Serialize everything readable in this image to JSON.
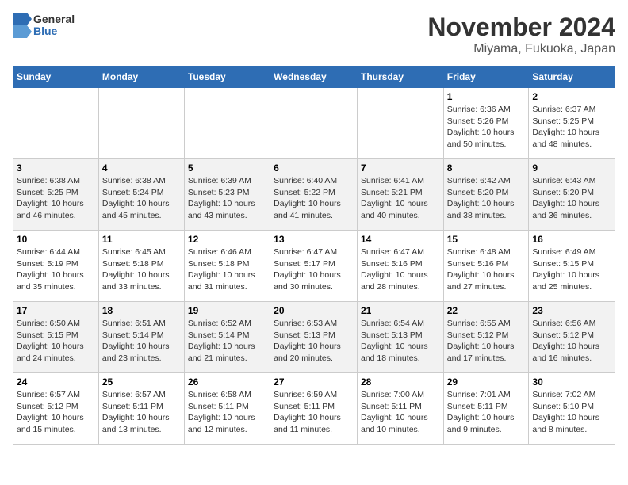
{
  "header": {
    "logo_general": "General",
    "logo_blue": "Blue",
    "title": "November 2024",
    "subtitle": "Miyama, Fukuoka, Japan"
  },
  "days_of_week": [
    "Sunday",
    "Monday",
    "Tuesday",
    "Wednesday",
    "Thursday",
    "Friday",
    "Saturday"
  ],
  "weeks": [
    [
      {
        "day": "",
        "info": ""
      },
      {
        "day": "",
        "info": ""
      },
      {
        "day": "",
        "info": ""
      },
      {
        "day": "",
        "info": ""
      },
      {
        "day": "",
        "info": ""
      },
      {
        "day": "1",
        "info": "Sunrise: 6:36 AM\nSunset: 5:26 PM\nDaylight: 10 hours and 50 minutes."
      },
      {
        "day": "2",
        "info": "Sunrise: 6:37 AM\nSunset: 5:25 PM\nDaylight: 10 hours and 48 minutes."
      }
    ],
    [
      {
        "day": "3",
        "info": "Sunrise: 6:38 AM\nSunset: 5:25 PM\nDaylight: 10 hours and 46 minutes."
      },
      {
        "day": "4",
        "info": "Sunrise: 6:38 AM\nSunset: 5:24 PM\nDaylight: 10 hours and 45 minutes."
      },
      {
        "day": "5",
        "info": "Sunrise: 6:39 AM\nSunset: 5:23 PM\nDaylight: 10 hours and 43 minutes."
      },
      {
        "day": "6",
        "info": "Sunrise: 6:40 AM\nSunset: 5:22 PM\nDaylight: 10 hours and 41 minutes."
      },
      {
        "day": "7",
        "info": "Sunrise: 6:41 AM\nSunset: 5:21 PM\nDaylight: 10 hours and 40 minutes."
      },
      {
        "day": "8",
        "info": "Sunrise: 6:42 AM\nSunset: 5:20 PM\nDaylight: 10 hours and 38 minutes."
      },
      {
        "day": "9",
        "info": "Sunrise: 6:43 AM\nSunset: 5:20 PM\nDaylight: 10 hours and 36 minutes."
      }
    ],
    [
      {
        "day": "10",
        "info": "Sunrise: 6:44 AM\nSunset: 5:19 PM\nDaylight: 10 hours and 35 minutes."
      },
      {
        "day": "11",
        "info": "Sunrise: 6:45 AM\nSunset: 5:18 PM\nDaylight: 10 hours and 33 minutes."
      },
      {
        "day": "12",
        "info": "Sunrise: 6:46 AM\nSunset: 5:18 PM\nDaylight: 10 hours and 31 minutes."
      },
      {
        "day": "13",
        "info": "Sunrise: 6:47 AM\nSunset: 5:17 PM\nDaylight: 10 hours and 30 minutes."
      },
      {
        "day": "14",
        "info": "Sunrise: 6:47 AM\nSunset: 5:16 PM\nDaylight: 10 hours and 28 minutes."
      },
      {
        "day": "15",
        "info": "Sunrise: 6:48 AM\nSunset: 5:16 PM\nDaylight: 10 hours and 27 minutes."
      },
      {
        "day": "16",
        "info": "Sunrise: 6:49 AM\nSunset: 5:15 PM\nDaylight: 10 hours and 25 minutes."
      }
    ],
    [
      {
        "day": "17",
        "info": "Sunrise: 6:50 AM\nSunset: 5:15 PM\nDaylight: 10 hours and 24 minutes."
      },
      {
        "day": "18",
        "info": "Sunrise: 6:51 AM\nSunset: 5:14 PM\nDaylight: 10 hours and 23 minutes."
      },
      {
        "day": "19",
        "info": "Sunrise: 6:52 AM\nSunset: 5:14 PM\nDaylight: 10 hours and 21 minutes."
      },
      {
        "day": "20",
        "info": "Sunrise: 6:53 AM\nSunset: 5:13 PM\nDaylight: 10 hours and 20 minutes."
      },
      {
        "day": "21",
        "info": "Sunrise: 6:54 AM\nSunset: 5:13 PM\nDaylight: 10 hours and 18 minutes."
      },
      {
        "day": "22",
        "info": "Sunrise: 6:55 AM\nSunset: 5:12 PM\nDaylight: 10 hours and 17 minutes."
      },
      {
        "day": "23",
        "info": "Sunrise: 6:56 AM\nSunset: 5:12 PM\nDaylight: 10 hours and 16 minutes."
      }
    ],
    [
      {
        "day": "24",
        "info": "Sunrise: 6:57 AM\nSunset: 5:12 PM\nDaylight: 10 hours and 15 minutes."
      },
      {
        "day": "25",
        "info": "Sunrise: 6:57 AM\nSunset: 5:11 PM\nDaylight: 10 hours and 13 minutes."
      },
      {
        "day": "26",
        "info": "Sunrise: 6:58 AM\nSunset: 5:11 PM\nDaylight: 10 hours and 12 minutes."
      },
      {
        "day": "27",
        "info": "Sunrise: 6:59 AM\nSunset: 5:11 PM\nDaylight: 10 hours and 11 minutes."
      },
      {
        "day": "28",
        "info": "Sunrise: 7:00 AM\nSunset: 5:11 PM\nDaylight: 10 hours and 10 minutes."
      },
      {
        "day": "29",
        "info": "Sunrise: 7:01 AM\nSunset: 5:11 PM\nDaylight: 10 hours and 9 minutes."
      },
      {
        "day": "30",
        "info": "Sunrise: 7:02 AM\nSunset: 5:10 PM\nDaylight: 10 hours and 8 minutes."
      }
    ]
  ]
}
